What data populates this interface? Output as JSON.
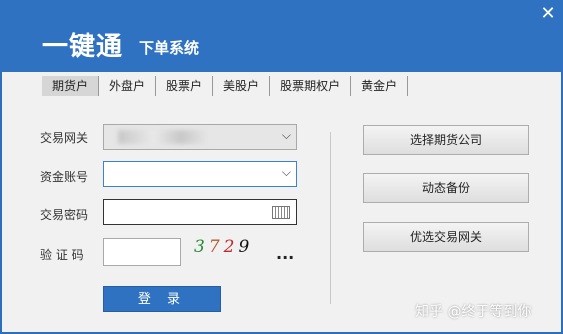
{
  "window": {
    "brand": "一键通",
    "subtitle": "下单系统",
    "close_icon": "close-icon"
  },
  "tabs": [
    {
      "label": "期货户",
      "active": true
    },
    {
      "label": "外盘户",
      "active": false
    },
    {
      "label": "股票户",
      "active": false
    },
    {
      "label": "美股户",
      "active": false
    },
    {
      "label": "股票期权户",
      "active": false
    },
    {
      "label": "黄金户",
      "active": false
    }
  ],
  "form": {
    "gateway_label": "交易网关",
    "gateway_value": "",
    "account_label": "资金账号",
    "account_value": "",
    "password_label": "交易密码",
    "password_value": "",
    "captcha_label": "验 证 码",
    "captcha_value": "",
    "captcha_chars": [
      "3",
      "7",
      "2",
      "9"
    ],
    "captcha_more": "...",
    "login_label": "登 录"
  },
  "right_buttons": {
    "select_company": "选择期货公司",
    "dynamic_backup": "动态备份",
    "optimal_gateway": "优选交易网关"
  },
  "watermark": "知乎 @终于等到你"
}
